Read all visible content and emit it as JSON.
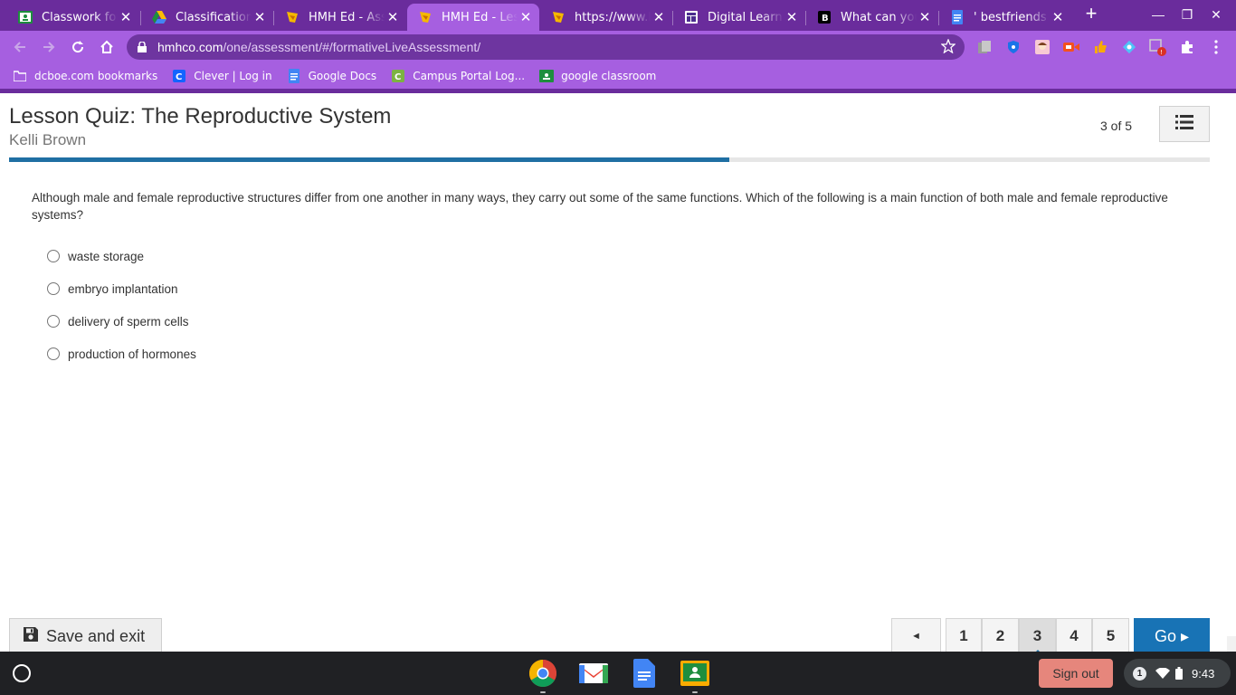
{
  "browser": {
    "tabs": [
      {
        "title": "Classwork for L",
        "icon": "google-classroom-icon",
        "active": false
      },
      {
        "title": "Classification- A",
        "icon": "google-drive-icon",
        "active": false
      },
      {
        "title": "HMH Ed - Assig",
        "icon": "hmh-icon",
        "active": false
      },
      {
        "title": "HMH Ed - Lesso",
        "icon": "hmh-icon",
        "active": true
      },
      {
        "title": "https://www.hm",
        "icon": "hmh-icon",
        "active": false
      },
      {
        "title": "Digital Learning",
        "icon": "google-sites-icon",
        "active": false
      },
      {
        "title": "What can you i",
        "icon": "brainly-icon",
        "active": false
      },
      {
        "title": "' bestfriends on",
        "icon": "google-docs-icon",
        "active": false
      }
    ],
    "url_host": "hmhco.com",
    "url_path": "/one/assessment/#/formativeLiveAssessment/",
    "bookmarks": [
      {
        "label": "dcboe.com bookmarks",
        "icon": "folder-icon"
      },
      {
        "label": "Clever | Log in",
        "icon": "clever-icon"
      },
      {
        "label": "Google Docs",
        "icon": "google-docs-icon"
      },
      {
        "label": "Campus Portal Log...",
        "icon": "campus-portal-icon"
      },
      {
        "label": "google classroom",
        "icon": "google-classroom-icon"
      }
    ]
  },
  "quiz": {
    "title": "Lesson Quiz: The Reproductive System",
    "student": "Kelli Brown",
    "counter": "3 of 5",
    "progress": 0.6,
    "question": "Although male and female reproductive structures differ from one another in many ways, they carry out some of the same functions. Which of the following is a main function of both male and female reproductive systems?",
    "options": [
      "waste storage",
      "embryo implantation",
      "delivery of sperm cells",
      "production of hormones"
    ],
    "save_label": "Save and exit",
    "pages": [
      "1",
      "2",
      "3",
      "4",
      "5"
    ],
    "current_page": "3",
    "prev_symbol": "◄",
    "go_label": "Go ▸"
  },
  "shelf": {
    "signout_label": "Sign out",
    "notifications": "1",
    "time": "9:43",
    "apps": [
      "chrome-icon",
      "gmail-icon",
      "google-docs-icon",
      "google-classroom-icon"
    ]
  },
  "colors": {
    "chrome_dark": "#6a2c9c",
    "chrome_light": "#a65fe0",
    "progress": "#1f6fa3",
    "go_button": "#1873b5",
    "signout": "#e6867c"
  }
}
